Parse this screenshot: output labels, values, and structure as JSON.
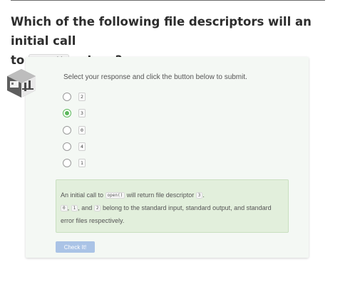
{
  "question": {
    "text_before": "Which of the following file descriptors will an initial call",
    "text_line2_start": "to",
    "code": "open()",
    "text_after": "return?"
  },
  "quiz": {
    "instruction": "Select your response and click the button below to submit.",
    "options": [
      {
        "value": "2",
        "selected": false
      },
      {
        "value": "3",
        "selected": true
      },
      {
        "value": "0",
        "selected": false
      },
      {
        "value": "4",
        "selected": false
      },
      {
        "value": "1",
        "selected": false
      }
    ],
    "feedback": {
      "p1": "An initial call to",
      "code_open": "open()",
      "p2": "will return file descriptor",
      "code_fd": "3",
      "p3": ".",
      "code_0": "0",
      "p4": ",",
      "code_1": "1",
      "p5": ", and",
      "code_2": "2",
      "p6": "belong to the standard input, standard output, and standard error files respectively."
    },
    "submit_label": "Check It!"
  },
  "colors": {
    "card_bg": "#f4f8f4",
    "feedback_bg": "#e2efdc",
    "selected_radio": "#5cb85c",
    "button_bg": "#aac3e6"
  }
}
